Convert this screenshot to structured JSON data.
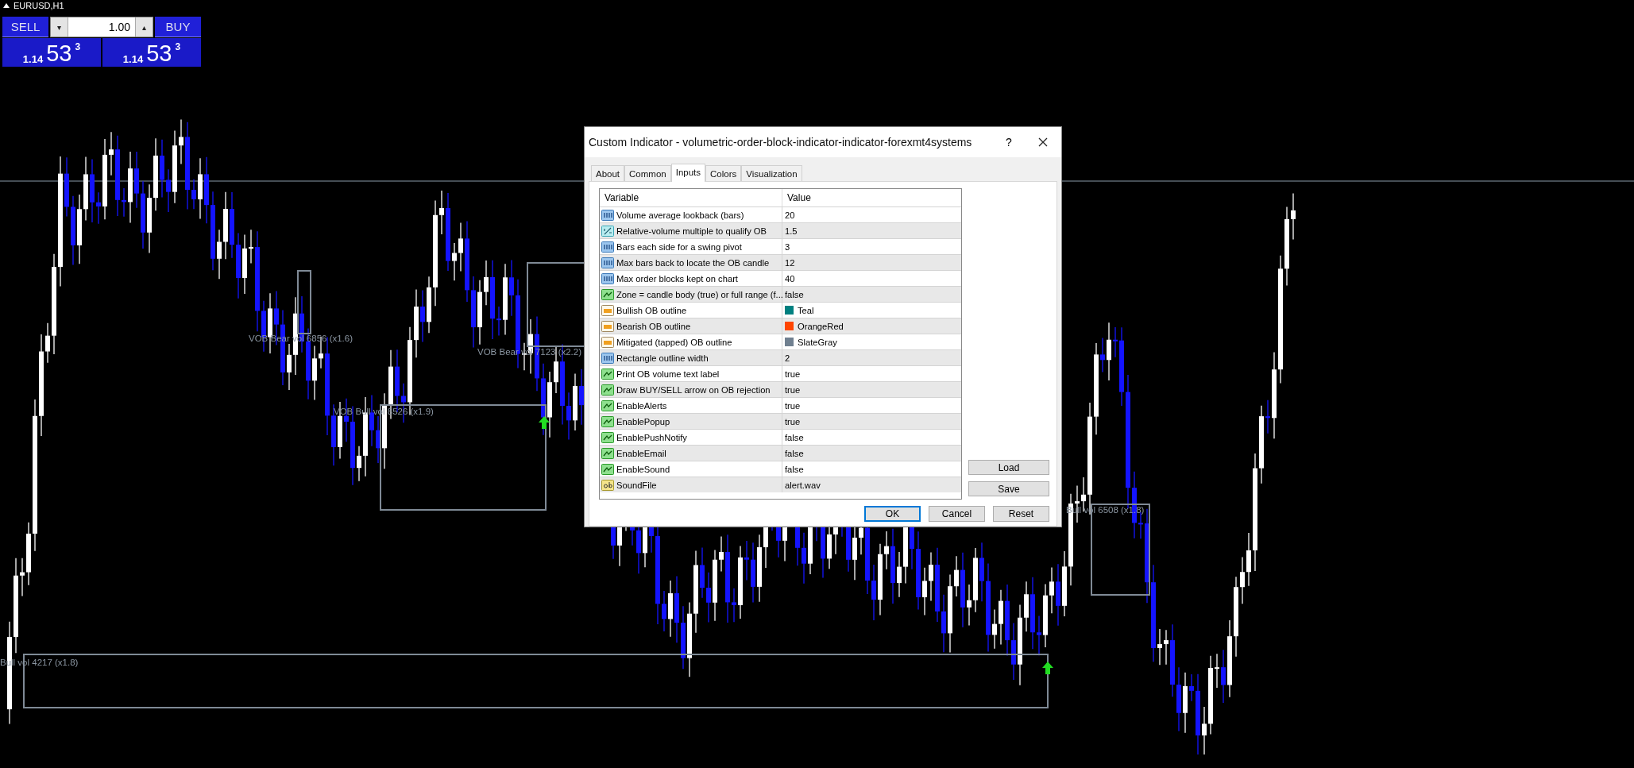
{
  "chart": {
    "symbol": "EURUSD,H1",
    "labels": [
      "VOB Bear vol 6856 (x1.6)",
      "VOB Bear vol 7123 (x2.2)",
      "VOB Bull vol 8526 (x1.9)",
      "Bull vol 4217 (x1.8)",
      "Bull vol 6508 (x1.8)"
    ]
  },
  "trade_panel": {
    "sell_label": "SELL",
    "buy_label": "BUY",
    "lot": "1.00",
    "down": "▾",
    "up": "▴",
    "sell_price": {
      "small": "1.14",
      "big": "53",
      "sup": "3"
    },
    "buy_price": {
      "small": "1.14",
      "big": "53",
      "sup": "3"
    }
  },
  "dialog": {
    "title": "Custom Indicator - volumetric-order-block-indicator-indicator-forexmt4systems",
    "help": "?",
    "tabs": [
      {
        "label": "About",
        "selected": false
      },
      {
        "label": "Common",
        "selected": false
      },
      {
        "label": "Inputs",
        "selected": true
      },
      {
        "label": "Colors",
        "selected": false
      },
      {
        "label": "Visualization",
        "selected": false
      }
    ],
    "columns": [
      "Variable",
      "Value"
    ],
    "rows": [
      {
        "kind": "int",
        "name": "Volume average lookback (bars)",
        "value": "20"
      },
      {
        "kind": "double",
        "name": "Relative-volume multiple to qualify OB",
        "value": "1.5"
      },
      {
        "kind": "int",
        "name": "Bars each side for a swing pivot",
        "value": "3"
      },
      {
        "kind": "int",
        "name": "Max bars back to locate the OB candle",
        "value": "12"
      },
      {
        "kind": "int",
        "name": "Max order blocks kept on chart",
        "value": "40"
      },
      {
        "kind": "bool",
        "name": "Zone = candle body (true) or full range (f...",
        "value": "false"
      },
      {
        "kind": "color",
        "name": "Bullish OB outline",
        "value": "Teal",
        "color": "#008080"
      },
      {
        "kind": "color",
        "name": "Bearish OB outline",
        "value": "OrangeRed",
        "color": "#ff4500"
      },
      {
        "kind": "color",
        "name": "Mitigated (tapped) OB outline",
        "value": "SlateGray",
        "color": "#708090"
      },
      {
        "kind": "int",
        "name": "Rectangle outline width",
        "value": "2"
      },
      {
        "kind": "bool",
        "name": "Print OB volume text label",
        "value": "true"
      },
      {
        "kind": "bool",
        "name": "Draw BUY/SELL arrow on OB rejection",
        "value": "true"
      },
      {
        "kind": "bool",
        "name": "EnableAlerts",
        "value": "true"
      },
      {
        "kind": "bool",
        "name": "EnablePopup",
        "value": "true"
      },
      {
        "kind": "bool",
        "name": "EnablePushNotify",
        "value": "false"
      },
      {
        "kind": "bool",
        "name": "EnableEmail",
        "value": "false"
      },
      {
        "kind": "bool",
        "name": "EnableSound",
        "value": "false"
      },
      {
        "kind": "string",
        "name": "SoundFile",
        "value": "alert.wav"
      }
    ],
    "side_buttons": [
      "Load",
      "Save"
    ],
    "buttons": [
      {
        "label": "OK",
        "default": true
      },
      {
        "label": "Cancel",
        "default": false
      },
      {
        "label": "Reset",
        "default": false
      }
    ]
  }
}
